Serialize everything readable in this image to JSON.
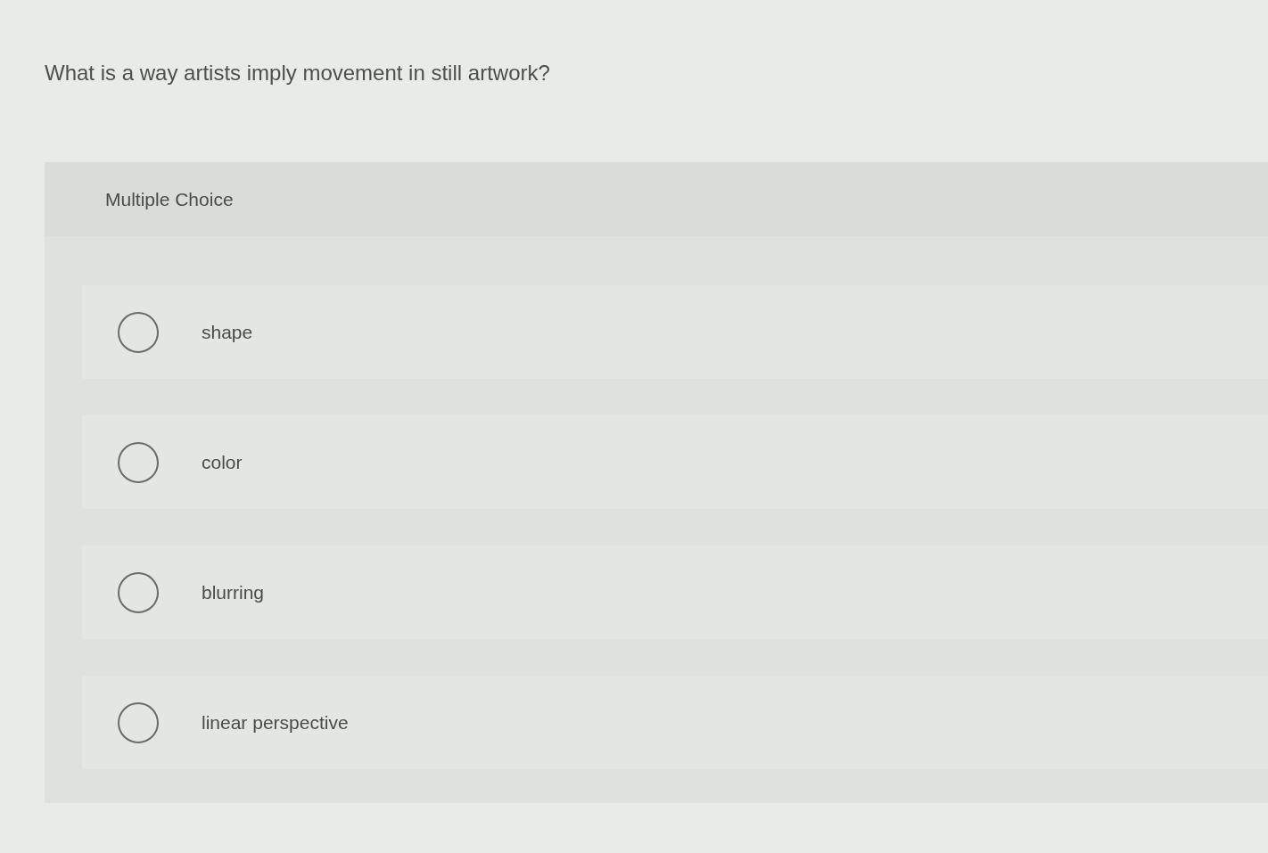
{
  "question": "What is a way artists imply movement in still artwork?",
  "panel": {
    "title": "Multiple Choice"
  },
  "options": [
    {
      "label": "shape",
      "selected": false
    },
    {
      "label": "color",
      "selected": false
    },
    {
      "label": "blurring",
      "selected": false
    },
    {
      "label": "linear perspective",
      "selected": false
    }
  ]
}
